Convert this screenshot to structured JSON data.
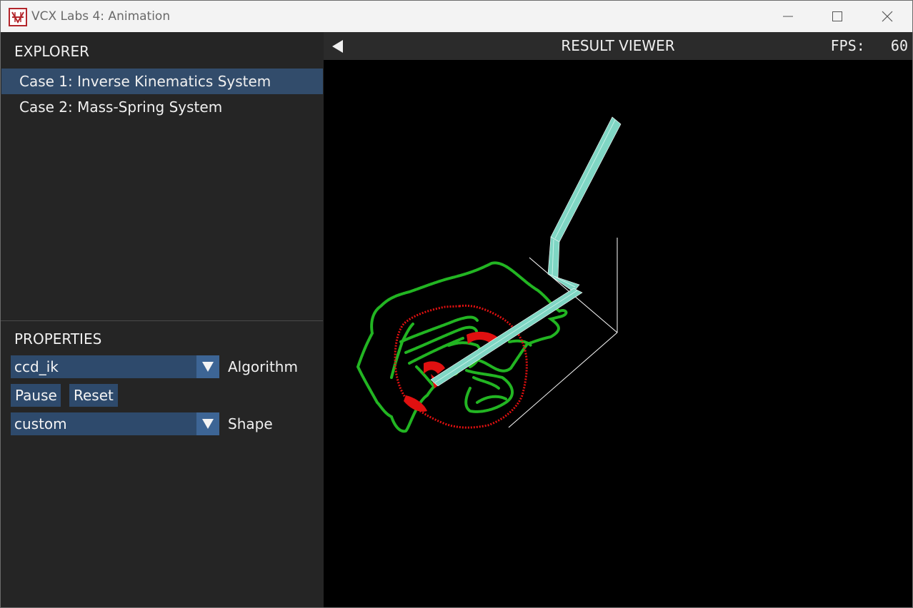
{
  "window": {
    "title": "VCX Labs 4: Animation",
    "app_icon": "vcx-logo-icon"
  },
  "explorer": {
    "header": "EXPLORER",
    "items": [
      {
        "label": "Case 1: Inverse Kinematics System",
        "selected": true
      },
      {
        "label": "Case 2: Mass-Spring System",
        "selected": false
      }
    ]
  },
  "properties": {
    "header": "PROPERTIES",
    "algorithm": {
      "value": "ccd_ik",
      "label": "Algorithm"
    },
    "pause_label": "Pause",
    "reset_label": "Reset",
    "shape": {
      "value": "custom",
      "label": "Shape"
    }
  },
  "viewer": {
    "title": "RESULT VIEWER",
    "fps_label": "FPS:",
    "fps_value": "60",
    "collapse_icon": "triangle-left-icon"
  },
  "colors": {
    "accent": "#324c6b",
    "button": "#2e4a6c",
    "arm": "#7fd6c4",
    "target_shape": "#22b522",
    "end_effector_trace": "#e01010",
    "axes": "#ffffff"
  }
}
